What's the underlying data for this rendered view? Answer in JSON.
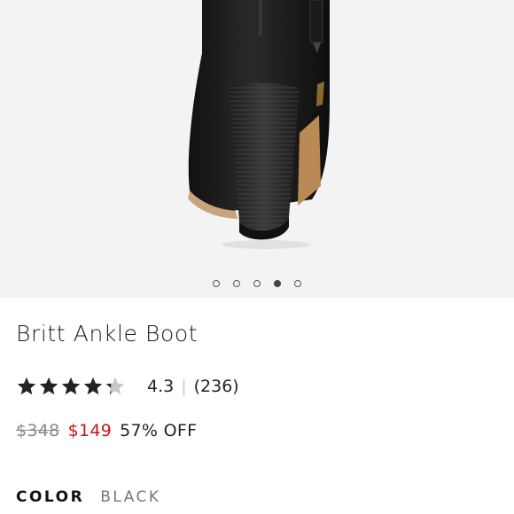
{
  "product": {
    "image_alt": "Black leather ankle boot with stacked heel, rear view",
    "title": "Britt Ankle Boot",
    "rating": {
      "value": 4.3,
      "display": "4.3",
      "separator": "|",
      "reviews": "(236)",
      "stars_total": 5
    },
    "price": {
      "original": "$348",
      "sale": "$149",
      "discount": "57% OFF"
    },
    "color": {
      "label": "COLOR",
      "value": "BLACK"
    }
  },
  "carousel": {
    "count": 5,
    "active_index": 3
  },
  "colors": {
    "hero_bg": "#f3f3f3",
    "sale_red": "#c4161c",
    "star_fill": "#222222",
    "star_empty": "#c8c8c8"
  }
}
